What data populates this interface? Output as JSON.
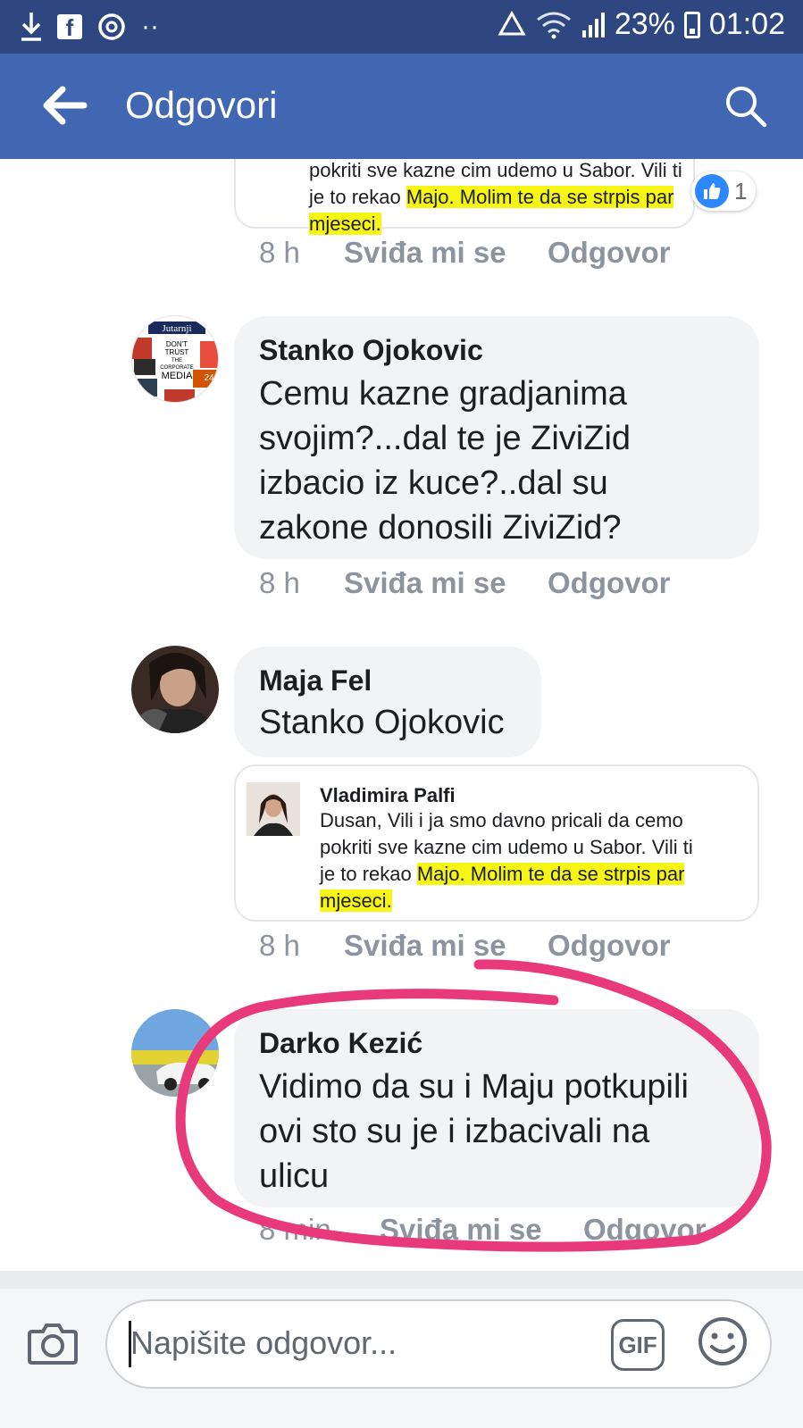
{
  "status_bar": {
    "battery": "23%",
    "time": "01:02",
    "icons": [
      "download-icon",
      "facebook-icon",
      "sync-icon",
      "more-dots-icon",
      "recycle-icon",
      "wifi-icon",
      "signal-icon",
      "battery-icon"
    ]
  },
  "app_bar": {
    "title": "Odgovori",
    "back_icon": "arrow-left-icon",
    "search_icon": "search-icon"
  },
  "comments": [
    {
      "partial_top": true,
      "screenshot_text_lines": [
        "pokriti sve kazne cim udemo u Sabor. Vili ti",
        "je to rekao "
      ],
      "screenshot_highlight_1": "Majo. Molim te da se strpis par",
      "screenshot_highlight_2": "mjeseci.",
      "like_count": "1",
      "time": "8 h",
      "like_label": "Sviđa mi se",
      "reply_label": "Odgovor"
    },
    {
      "author": "Stanko Ojokovic",
      "text": "Cemu kazne gradjanima svojim?...dal te je ZiviZid izbacio iz kuce?..dal su zakone donosili ZiviZid?",
      "lines": [
        "Cemu kazne gradjanima",
        "svojim?...dal te je ZiviZid",
        "izbacio iz kuce?..dal su",
        "zakone donosili ZiviZid?"
      ],
      "avatar_text": [
        "Jutarnji",
        "DON'T",
        "TRUST",
        "THE",
        "CORPORATE",
        "MEDIA",
        "24"
      ],
      "time": "8 h",
      "like_label": "Sviđa mi se",
      "reply_label": "Odgovor"
    },
    {
      "author": "Maja Fel",
      "text": "Stanko Ojokovic",
      "screenshot": {
        "name": "Vladimira Palfi",
        "line1": "Dusan, Vili i ja smo davno pricali da cemo",
        "line2": "pokriti sve kazne cim udemo u Sabor. Vili ti",
        "line3_plain": "je to rekao ",
        "line3_highlight": "Majo. Molim te da se strpis par",
        "line4_highlight": "mjeseci."
      },
      "time": "8 h",
      "like_label": "Sviđa mi se",
      "reply_label": "Odgovor"
    },
    {
      "author": "Darko Kezić",
      "lines": [
        "Vidimo da su i Maju potkupili",
        "ovi sto su je i izbacivali na",
        "ulicu"
      ],
      "time": "8 min",
      "like_label": "Sviđa mi se",
      "reply_label": "Odgovor"
    }
  ],
  "composer": {
    "placeholder": "Napišite odgovor...",
    "gif_label": "GIF",
    "camera_icon": "camera-icon",
    "emoji_icon": "smiley-icon"
  },
  "colors": {
    "status_bar": "#2f4781",
    "app_bar": "#4267b2",
    "bubble": "#f2f3f5",
    "highlight": "#f7f516",
    "annotation": "#e8397a",
    "like_blue": "#2d88ff"
  }
}
